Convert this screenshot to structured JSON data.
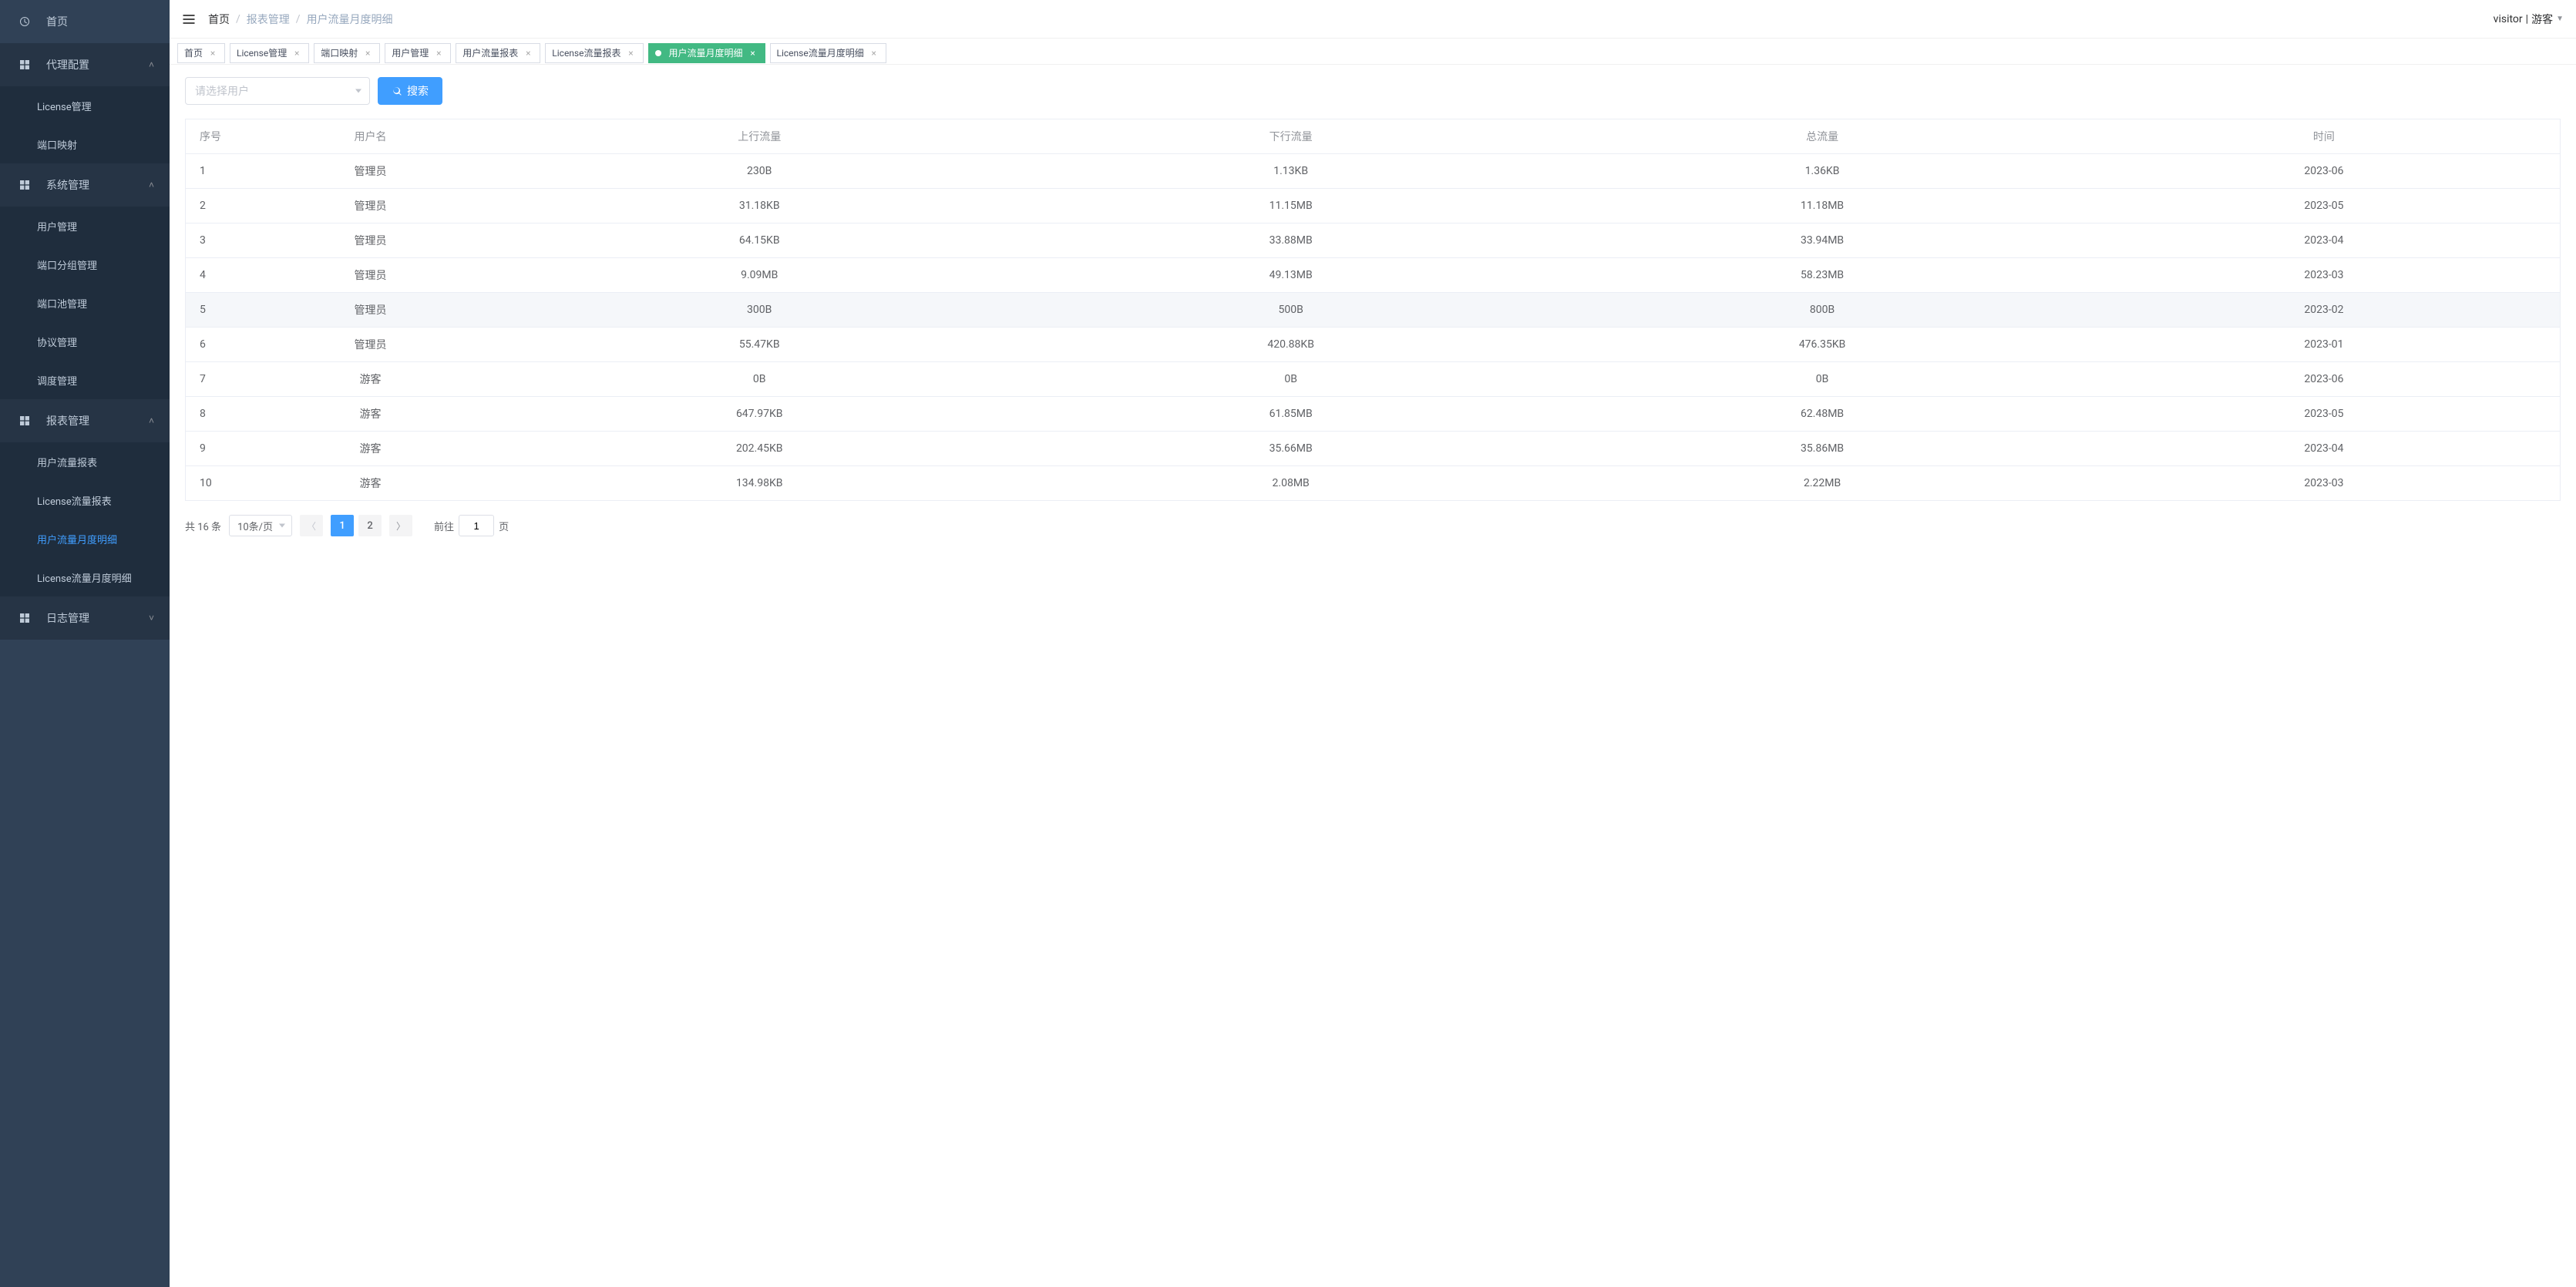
{
  "sidebar": {
    "home": "首页",
    "groups": [
      {
        "title": "代理配置",
        "expanded": true,
        "items": [
          "License管理",
          "端口映射"
        ]
      },
      {
        "title": "系统管理",
        "expanded": true,
        "items": [
          "用户管理",
          "端口分组管理",
          "端口池管理",
          "协议管理",
          "调度管理"
        ]
      },
      {
        "title": "报表管理",
        "expanded": true,
        "active_index": 2,
        "items": [
          "用户流量报表",
          "License流量报表",
          "用户流量月度明细",
          "License流量月度明细"
        ]
      },
      {
        "title": "日志管理",
        "expanded": false,
        "items": []
      }
    ]
  },
  "breadcrumb": [
    "首页",
    "报表管理",
    "用户流量月度明细"
  ],
  "user": {
    "name": "visitor",
    "role": "游客"
  },
  "tabs": [
    {
      "label": "首页",
      "closable": true
    },
    {
      "label": "License管理",
      "closable": true
    },
    {
      "label": "端口映射",
      "closable": true
    },
    {
      "label": "用户管理",
      "closable": true
    },
    {
      "label": "用户流量报表",
      "closable": true
    },
    {
      "label": "License流量报表",
      "closable": true
    },
    {
      "label": "用户流量月度明细",
      "closable": true,
      "active": true
    },
    {
      "label": "License流量月度明细",
      "closable": true
    }
  ],
  "search": {
    "placeholder": "请选择用户",
    "btn": "搜索"
  },
  "table": {
    "columns": [
      "序号",
      "用户名",
      "上行流量",
      "下行流量",
      "总流量",
      "时间"
    ],
    "rows": [
      [
        "1",
        "管理员",
        "230B",
        "1.13KB",
        "1.36KB",
        "2023-06"
      ],
      [
        "2",
        "管理员",
        "31.18KB",
        "11.15MB",
        "11.18MB",
        "2023-05"
      ],
      [
        "3",
        "管理员",
        "64.15KB",
        "33.88MB",
        "33.94MB",
        "2023-04"
      ],
      [
        "4",
        "管理员",
        "9.09MB",
        "49.13MB",
        "58.23MB",
        "2023-03"
      ],
      [
        "5",
        "管理员",
        "300B",
        "500B",
        "800B",
        "2023-02"
      ],
      [
        "6",
        "管理员",
        "55.47KB",
        "420.88KB",
        "476.35KB",
        "2023-01"
      ],
      [
        "7",
        "游客",
        "0B",
        "0B",
        "0B",
        "2023-06"
      ],
      [
        "8",
        "游客",
        "647.97KB",
        "61.85MB",
        "62.48MB",
        "2023-05"
      ],
      [
        "9",
        "游客",
        "202.45KB",
        "35.66MB",
        "35.86MB",
        "2023-04"
      ],
      [
        "10",
        "游客",
        "134.98KB",
        "2.08MB",
        "2.22MB",
        "2023-03"
      ]
    ]
  },
  "pagination": {
    "total_text": "共 16 条",
    "page_size": "10条/页",
    "pages": [
      "1",
      "2"
    ],
    "active_page": "1",
    "goto_prefix": "前往",
    "goto_value": "1",
    "goto_suffix": "页"
  }
}
